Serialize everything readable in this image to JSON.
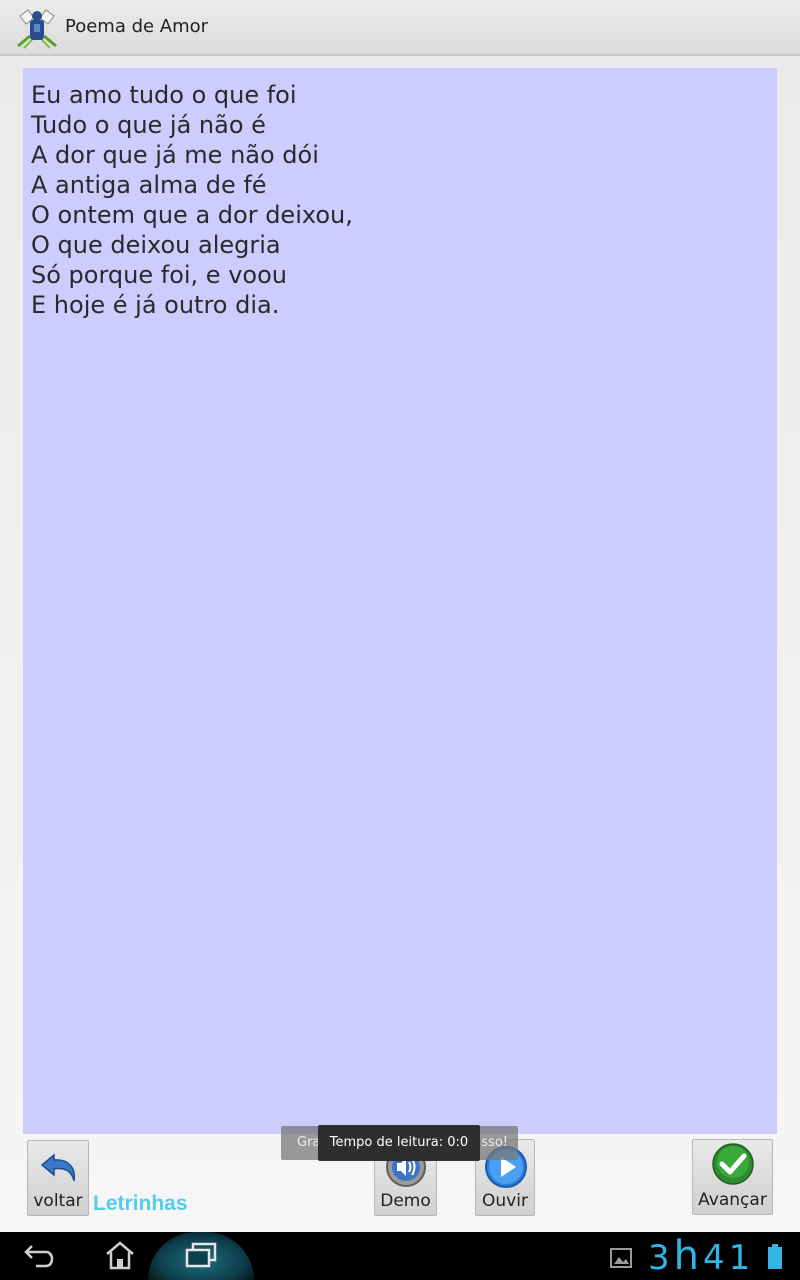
{
  "app": {
    "title": "Poema de Amor",
    "icon": "app-logo-icon"
  },
  "poem": {
    "lines": [
      "Eu amo tudo o que foi",
      "Tudo o que já não é",
      "A dor que já me não dói",
      "A antiga alma de fé",
      "O ontem que a dor deixou,",
      "O que deixou alegria",
      "Só porque foi, e voou",
      "E hoje é já outro dia."
    ],
    "background": "#ccccfe"
  },
  "toolbar": {
    "back_label": "voltar",
    "brand_label": "Letrinhas",
    "demo_label": "Demo",
    "listen_label": "Ouvir",
    "next_label": "Avançar"
  },
  "toasts": {
    "back_left": "Gra",
    "back_right": "sso!",
    "front": "Tempo de leitura: 0:0"
  },
  "statusbar": {
    "clock_hour": "3",
    "clock_sep": "h",
    "clock_min": "41"
  },
  "colors": {
    "accent": "#32b5e5",
    "brand": "#55ccee"
  }
}
